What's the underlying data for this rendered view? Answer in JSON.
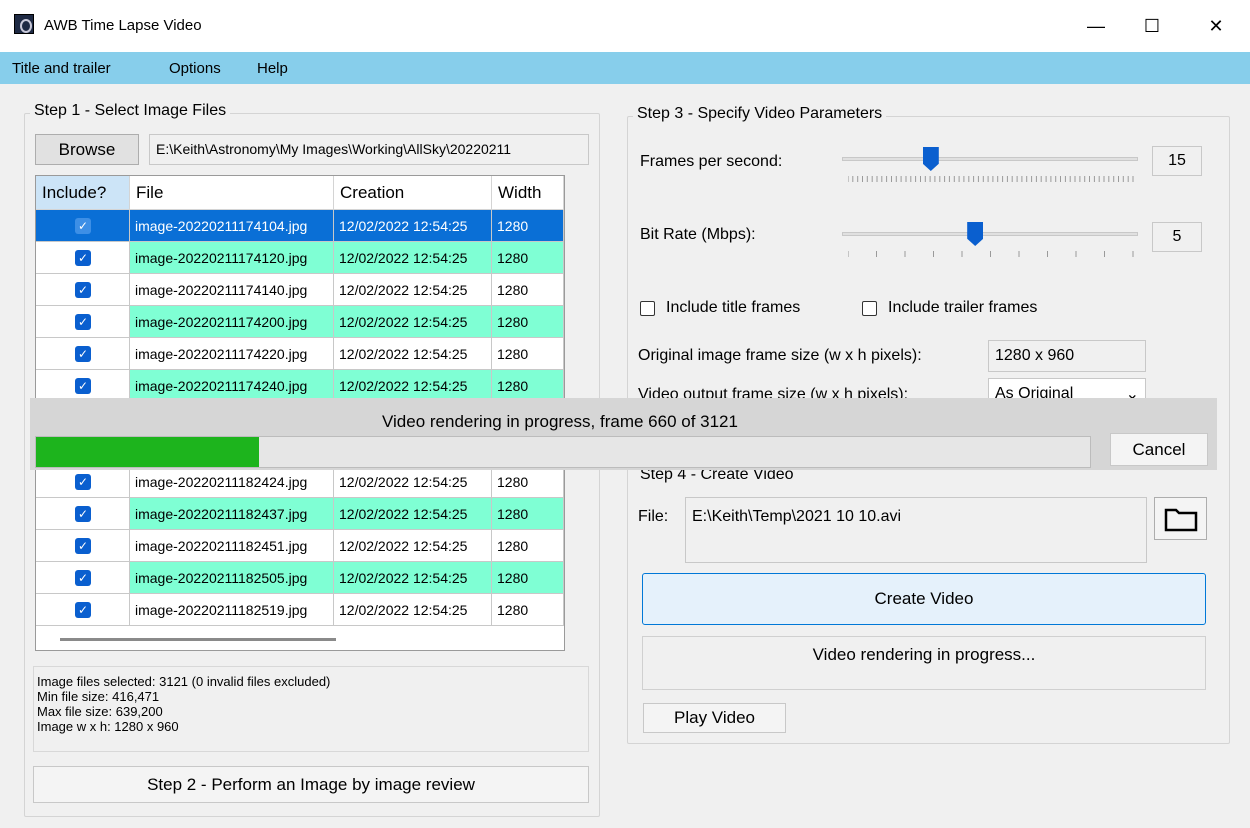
{
  "window": {
    "title": "AWB Time Lapse Video",
    "min": "—",
    "max": "☐",
    "close": "✕"
  },
  "menu": [
    "Title and trailer",
    "Options",
    "Help"
  ],
  "step1": {
    "title": "Step 1 - Select Image Files",
    "browse": "Browse",
    "path": "E:\\Keith\\Astronomy\\My Images\\Working\\AllSky\\20220211",
    "columns": [
      "Include?",
      "File",
      "Creation",
      "Width"
    ],
    "rows_top": [
      {
        "file": "image-20220211174104.jpg",
        "creation": "12/02/2022 12:54:25",
        "width": "1280"
      },
      {
        "file": "image-20220211174120.jpg",
        "creation": "12/02/2022 12:54:25",
        "width": "1280"
      },
      {
        "file": "image-20220211174140.jpg",
        "creation": "12/02/2022 12:54:25",
        "width": "1280"
      },
      {
        "file": "image-20220211174200.jpg",
        "creation": "12/02/2022 12:54:25",
        "width": "1280"
      },
      {
        "file": "image-20220211174220.jpg",
        "creation": "12/02/2022 12:54:25",
        "width": "1280"
      },
      {
        "file": "image-20220211174240.jpg",
        "creation": "12/02/2022 12:54:25",
        "width": "1280"
      }
    ],
    "rows_bottom": [
      {
        "file": "image-20220211182424.jpg",
        "creation": "12/02/2022 12:54:25",
        "width": "1280"
      },
      {
        "file": "image-20220211182437.jpg",
        "creation": "12/02/2022 12:54:25",
        "width": "1280"
      },
      {
        "file": "image-20220211182451.jpg",
        "creation": "12/02/2022 12:54:25",
        "width": "1280"
      },
      {
        "file": "image-20220211182505.jpg",
        "creation": "12/02/2022 12:54:25",
        "width": "1280"
      },
      {
        "file": "image-20220211182519.jpg",
        "creation": "12/02/2022 12:54:25",
        "width": "1280"
      }
    ],
    "check_glyph": "✓",
    "summary": [
      "Image files selected: 3121  (0 invalid files excluded)",
      "Min file size: 416,471",
      "Max file size: 639,200",
      "Image w x h: 1280 x 960"
    ]
  },
  "step2": {
    "button": "Step 2 - Perform an Image by image review"
  },
  "step3": {
    "title": "Step 3 - Specify Video Parameters",
    "fps_label": "Frames per second:",
    "fps_value": "15",
    "fps_fraction": 0.3,
    "bitrate_label": "Bit Rate (Mbps):",
    "bitrate_value": "5",
    "bitrate_fraction": 0.45,
    "include_title": "Include title frames",
    "include_trailer": "Include trailer frames",
    "orig_size_label": "Original image frame size (w x h pixels):",
    "orig_size_value": "1280 x 960",
    "out_size_label": "Video output frame size (w x h pixels):",
    "out_size_value": "As Original"
  },
  "progress": {
    "text": "Video rendering in progress, frame 660 of 3121",
    "cancel": "Cancel",
    "fraction": 0.2115,
    "color": "#1db41d"
  },
  "step4": {
    "title": "Step 4 - Create Video",
    "file_label": "File:",
    "file_value": "E:\\Keith\\Temp\\2021 10 10.avi",
    "create": "Create Video",
    "status": "Video rendering in progress...",
    "play": "Play Video"
  },
  "colors": {
    "menu_bar": "#87ceeb",
    "row_alt": "#7fffd4",
    "row_selected": "#0a6fd6",
    "checkbox": "#0a5fcf"
  }
}
